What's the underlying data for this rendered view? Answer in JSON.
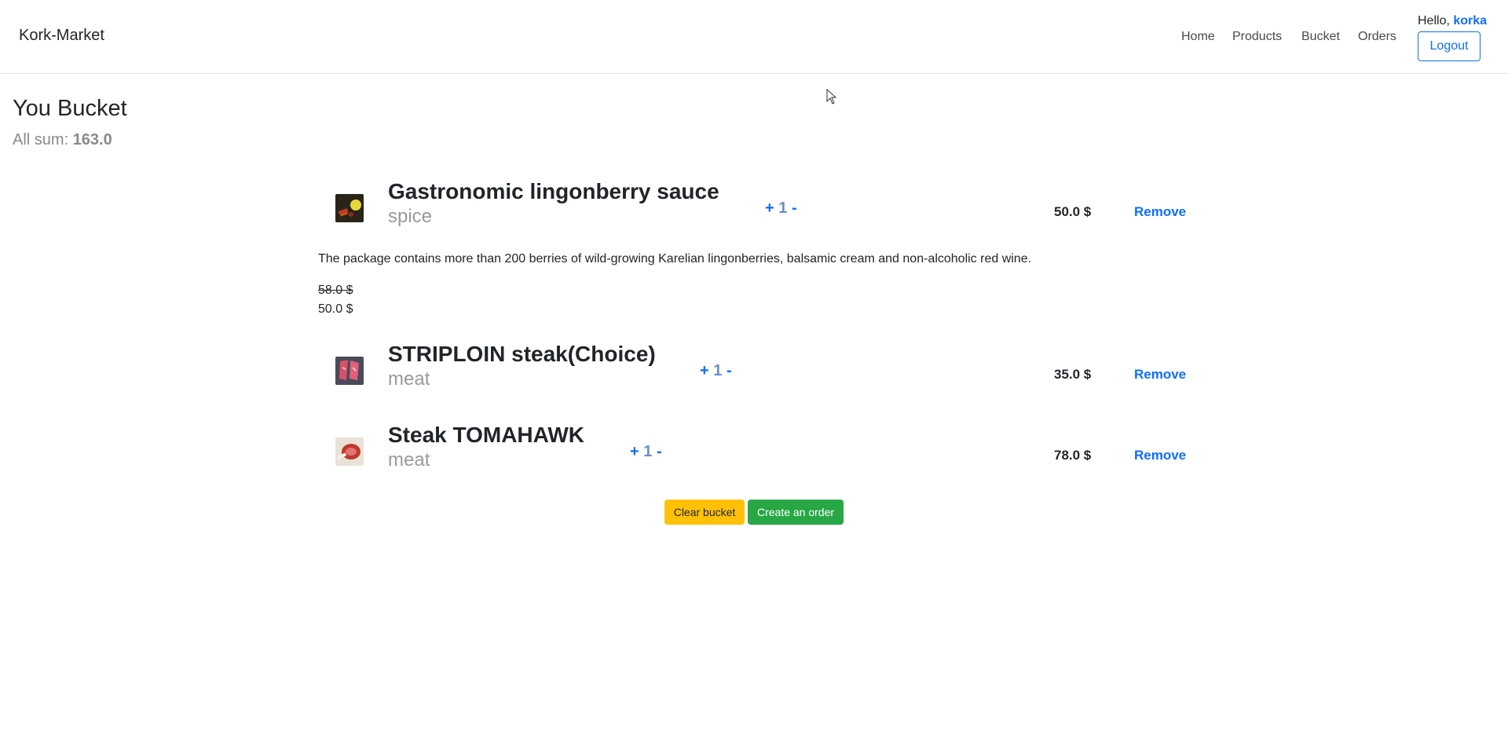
{
  "navbar": {
    "brand": "Kork-Market",
    "links": [
      "Home",
      "Products",
      "Bucket",
      "Orders"
    ],
    "hello_prefix": "Hello,",
    "username": "korka",
    "logout_label": "Logout"
  },
  "page": {
    "title": "You Bucket",
    "sum_label": "All sum:",
    "sum_value": "163.0"
  },
  "items": [
    {
      "name": "Gastronomic lingonberry sauce",
      "category": "spice",
      "qty_plus": "+",
      "qty": "1",
      "qty_minus": "-",
      "price": "50.0 $",
      "remove_label": "Remove",
      "description": "The package contains more than 200 berries of wild-growing Karelian lingonberries, balsamic cream and non-alcoholic red wine.",
      "old_price": "58.0 $",
      "new_price": "50.0 $",
      "thumb_icon": "sauce-image-icon"
    },
    {
      "name": "STRIPLOIN steak(Choice)",
      "category": "meat",
      "qty_plus": "+",
      "qty": "1",
      "qty_minus": "-",
      "price": "35.0 $",
      "remove_label": "Remove",
      "thumb_icon": "steak-image-icon"
    },
    {
      "name": "Steak TOMAHAWK",
      "category": "meat",
      "qty_plus": "+",
      "qty": "1",
      "qty_minus": "-",
      "price": "78.0 $",
      "remove_label": "Remove",
      "thumb_icon": "tomahawk-image-icon"
    }
  ],
  "actions": {
    "clear_label": "Clear bucket",
    "order_label": "Create an order"
  },
  "colors": {
    "primary": "#0d6efd",
    "warning": "#ffc107",
    "success": "#28a745"
  }
}
